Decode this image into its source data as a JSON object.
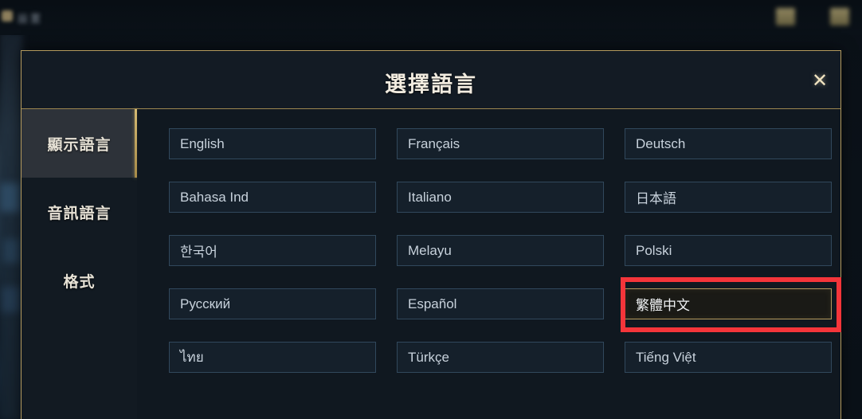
{
  "background": {
    "top_left_label": "設置",
    "top_left_icon": "chevron-left-icon",
    "top_right_icons": [
      "blurred-gold-icon-1",
      "blurred-gold-icon-2"
    ]
  },
  "dialog": {
    "title": "選擇語言",
    "close_label": "✕",
    "sidebar": {
      "items": [
        {
          "label": "顯示語言",
          "active": true
        },
        {
          "label": "音訊語言",
          "active": false
        },
        {
          "label": "格式",
          "active": false
        }
      ]
    },
    "languages": [
      {
        "label": "English",
        "selected": false
      },
      {
        "label": "Français",
        "selected": false
      },
      {
        "label": "Deutsch",
        "selected": false
      },
      {
        "label": "Bahasa Ind",
        "selected": false
      },
      {
        "label": "Italiano",
        "selected": false
      },
      {
        "label": "日本語",
        "selected": false
      },
      {
        "label": "한국어",
        "selected": false
      },
      {
        "label": "Melayu",
        "selected": false
      },
      {
        "label": "Polski",
        "selected": false
      },
      {
        "label": "Русский",
        "selected": false
      },
      {
        "label": "Español",
        "selected": false
      },
      {
        "label": "繁體中文",
        "selected": true
      },
      {
        "label": "ไทย",
        "selected": false
      },
      {
        "label": "Türkçe",
        "selected": false
      },
      {
        "label": "Tiếng Việt",
        "selected": false
      }
    ]
  },
  "annotation": {
    "color": "#f4353a",
    "target": "繁體中文"
  },
  "colors": {
    "dialog_border_gold": "#b49a5e",
    "dialog_bg": "#131b24",
    "content_bg": "#101820",
    "button_border": "#31485c",
    "selected_border": "#b49a5e",
    "accent_gold": "#d4b972",
    "annotation_red": "#f4353a",
    "text_primary": "#f2ece0",
    "text_secondary": "#c8d2dc"
  }
}
